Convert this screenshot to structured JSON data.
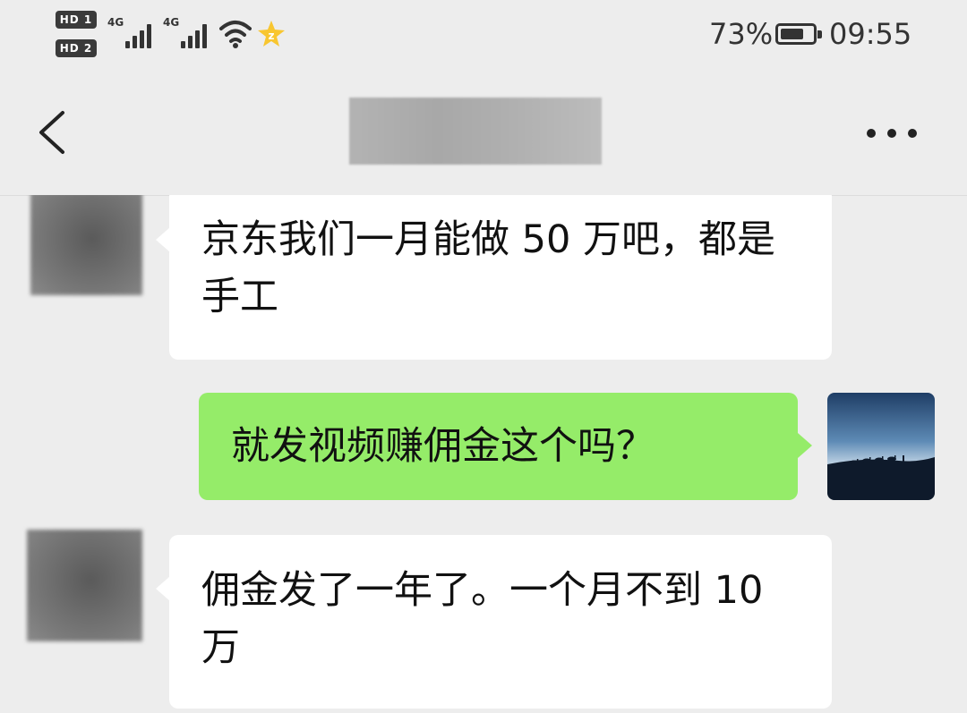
{
  "status_bar": {
    "sim1_label": "HD 1",
    "sim2_label": "HD 2",
    "network1": "4G",
    "network2": "4G",
    "battery_percent": "73%",
    "battery_level": 0.73,
    "time": "09:55",
    "icons": [
      "signal-icon",
      "wifi-icon",
      "qq-star-icon",
      "battery-icon"
    ]
  },
  "nav": {
    "back_icon": "chevron-left-icon",
    "title": "",
    "more_icon": "more-dots-icon"
  },
  "messages": [
    {
      "side": "in",
      "text": "京东我们一月能做 50 万吧，都是手工"
    },
    {
      "side": "out",
      "text": "就发视频赚佣金这个吗？"
    },
    {
      "side": "in",
      "text": "佣金发了一年了。一个月不到 10 万"
    }
  ],
  "colors": {
    "background": "#ededed",
    "bubble_out": "#95ec69",
    "bubble_in": "#ffffff"
  }
}
